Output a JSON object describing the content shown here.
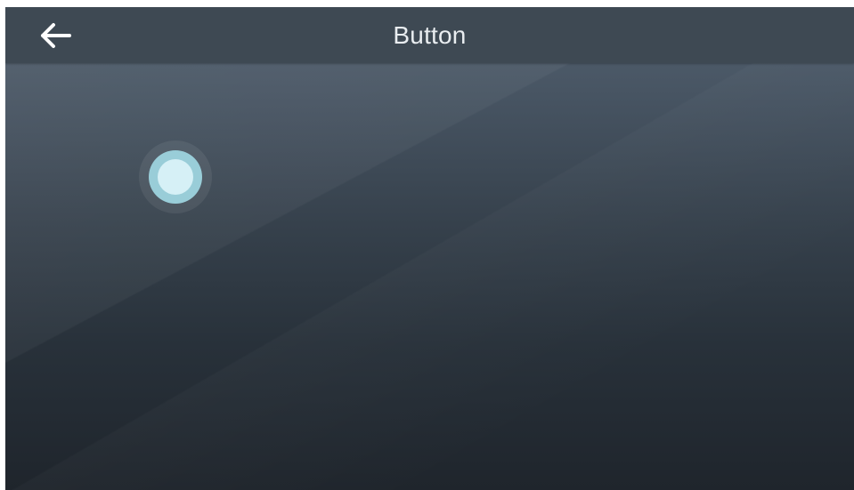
{
  "header": {
    "title": "Button",
    "back_icon": "arrow-left-icon"
  },
  "content": {
    "button_icon": "circle-dot-icon"
  },
  "colors": {
    "header_background": "#3e4953",
    "title_text": "#e9edf0",
    "button_ring": "#99cdd8",
    "button_core": "#d6f0f6"
  }
}
